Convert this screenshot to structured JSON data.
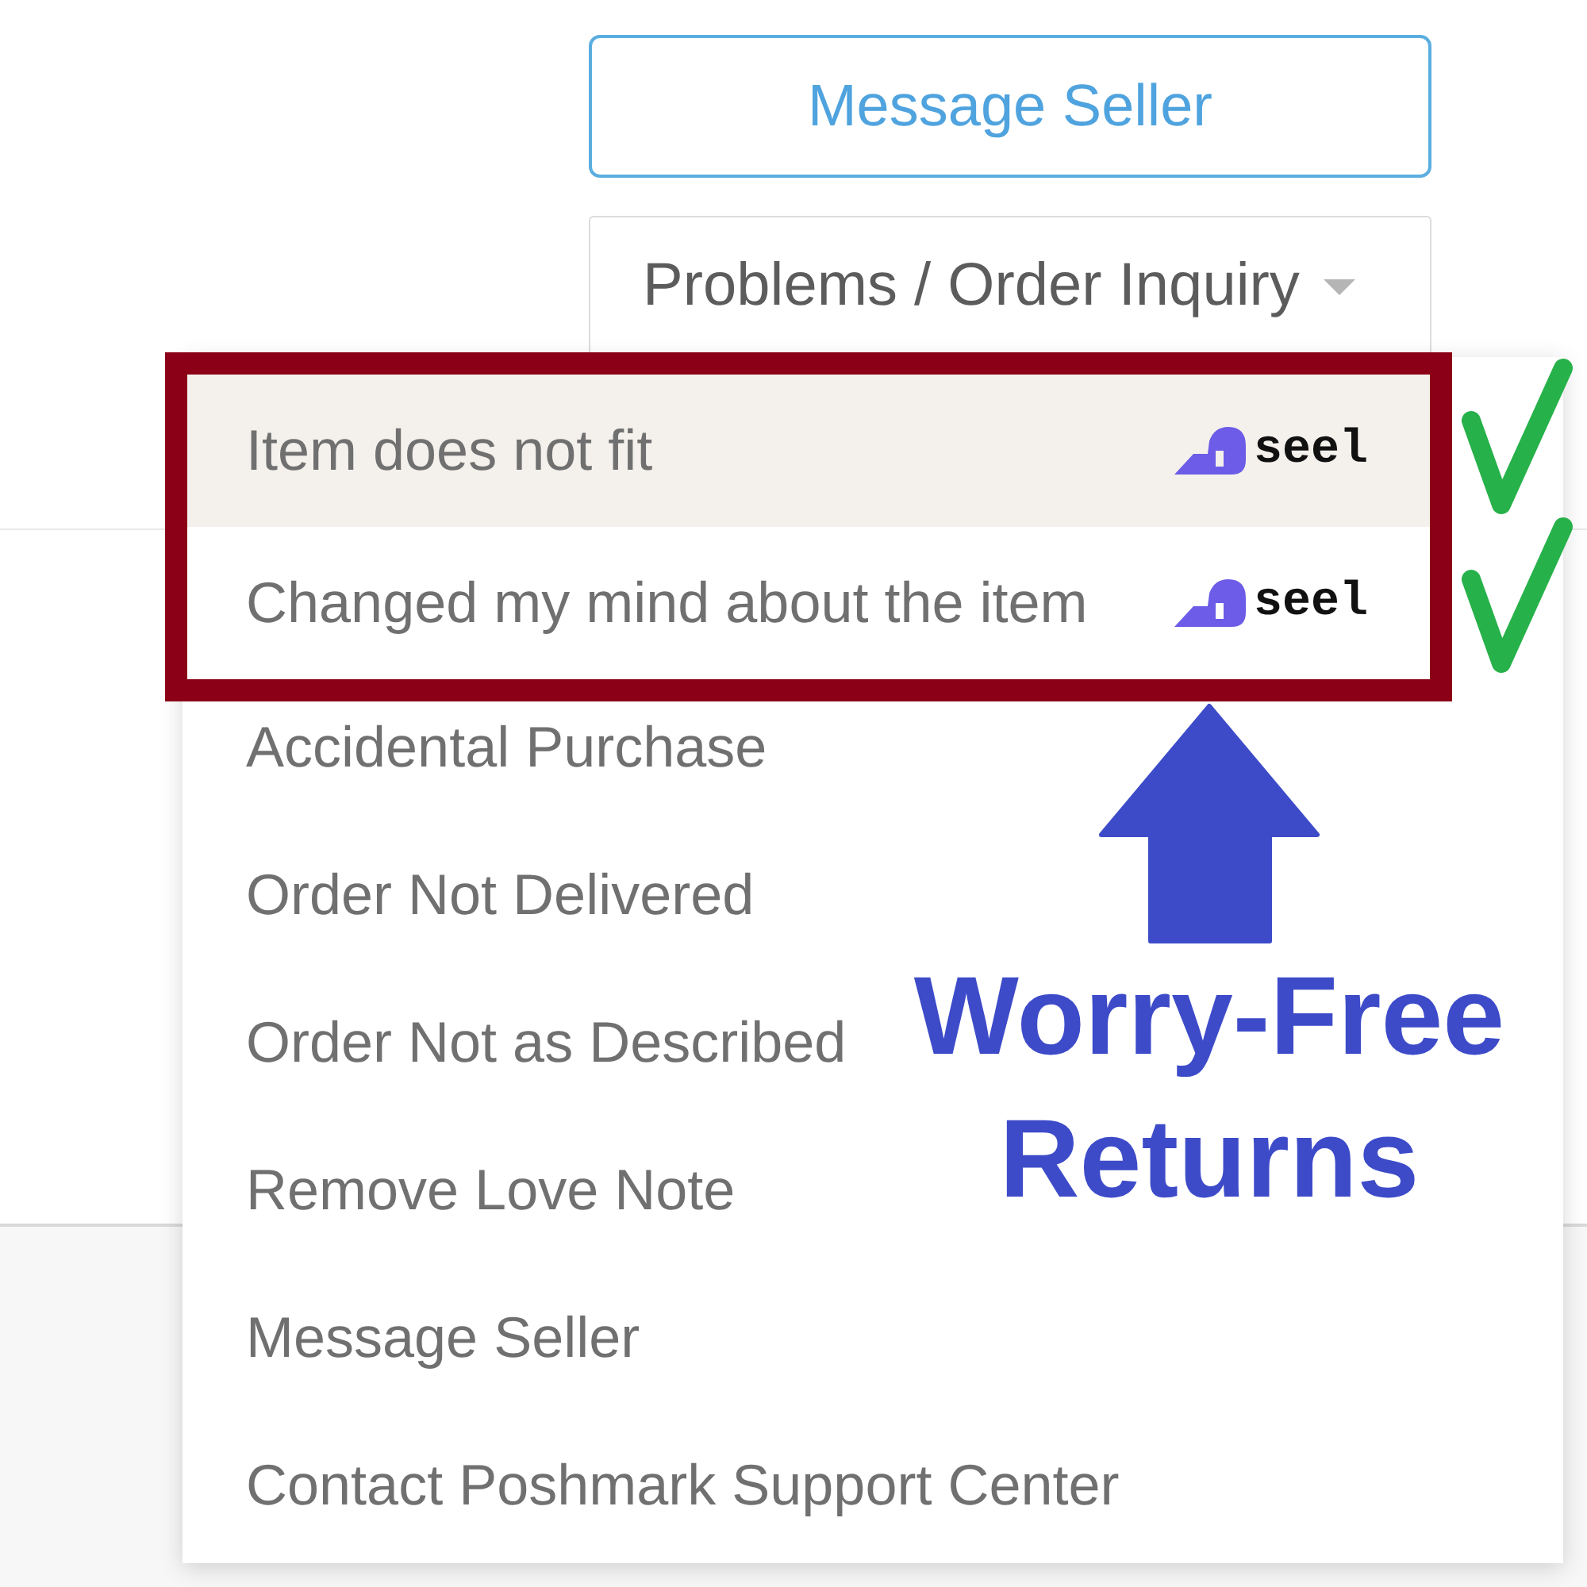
{
  "actions": [
    {
      "kind": "outline",
      "label": "Message Seller"
    },
    {
      "kind": "dropdown",
      "label": "Problems / Order Inquiry",
      "expanded": true,
      "items": [
        {
          "label": "Item does not fit",
          "selected": true,
          "badge": "seel",
          "annotated": true
        },
        {
          "label": "Changed my mind about the item",
          "selected": false,
          "badge": "seel",
          "annotated": true
        },
        {
          "label": "Accidental Purchase",
          "selected": false,
          "annotated": false
        },
        {
          "label": "Order Not Delivered",
          "selected": false,
          "annotated": false
        },
        {
          "label": "Order Not as Described",
          "selected": false,
          "annotated": false
        },
        {
          "label": "Remove Love Note",
          "selected": false,
          "annotated": false
        },
        {
          "label": "Message Seller",
          "selected": false,
          "annotated": false
        },
        {
          "label": "Contact Poshmark Support Center",
          "selected": false,
          "annotated": false
        }
      ]
    }
  ],
  "annotation": {
    "callout": "Worry-Free Returns"
  }
}
